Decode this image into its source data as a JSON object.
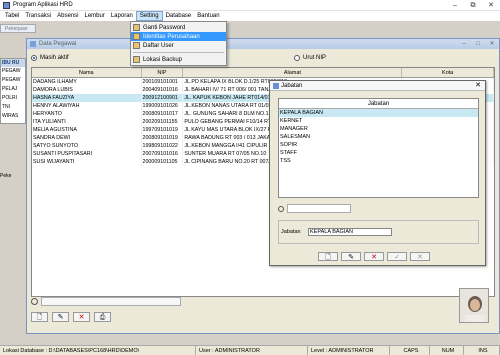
{
  "window": {
    "title": "Program Aplikasi HRD",
    "controls": [
      "–",
      "⧉",
      "✕"
    ]
  },
  "menubar": {
    "items": [
      "Tabel",
      "Transaksi",
      "Absensi",
      "Lembur",
      "Laporan",
      "Setting",
      "Database",
      "Bantuan"
    ],
    "active": "Setting"
  },
  "setting_menu": {
    "items": [
      "Ganti Password",
      "Identitas Perusahaan",
      "Daftar User"
    ],
    "highlighted": "Identitas Perusahaan",
    "after_separator": "Lokasi Backup"
  },
  "pekerjaan_panel": {
    "title": "Pekerjaan",
    "list_header": "IBU RU",
    "items": [
      "PEGAW",
      "PEGAW",
      "PELAJ",
      "POLRI",
      "TNI",
      "WIRAS"
    ],
    "footer_label": "Peke"
  },
  "data_pegawai": {
    "title": "Data Pegawai",
    "radio_active": "Masih aktif",
    "radio_sort": "Urut NIP",
    "columns": [
      "Nama",
      "NIP",
      "Alamat",
      "Kota"
    ],
    "rows": [
      [
        "DADANG ILHAMY",
        "200109101001",
        "JL.PD KELAPA IX BLOK D.1/25 RT003/013",
        ""
      ],
      [
        "DAMORA LUBIS",
        "200409101016",
        "JL BAHARI IV/ 71 RT 006/ 001 TANJUNG PRIOK",
        ""
      ],
      [
        "HASNA FAUZIYA",
        "200912100901",
        "JL. KAPUK KEBON JAHE RT014/012",
        ""
      ],
      [
        "HENNY ALAWIYAH",
        "199009101026",
        "JL.KEBON NANAS UTARA RT 01/07",
        ""
      ],
      [
        "HERYANTO",
        "200809101017",
        "JL. GUNUNG SAHARI 8 DLM NO.1 RT 013/001",
        ""
      ],
      [
        "ITA YULIANTI",
        "200209101155",
        "PULO GEBANG PERMAI F10/14 RT 005/003",
        ""
      ],
      [
        "MELIA AGUSTINA",
        "199709101019",
        "JL KAYU MAS UTARA BLOK IX/27 RT 011",
        ""
      ],
      [
        "SANDRA DEWI",
        "200809101019",
        "RAWA BADUNG RT 003 / 013 JAKARTA TIMUR",
        ""
      ],
      [
        "SATYO SUNYOTO",
        "199809101022",
        "JL.KEBON MANGGA I/41 CIPULIR RT 006/005",
        ""
      ],
      [
        "SUSANTI PUSPITASARI",
        "200709101016",
        "SUNTER MUARA RT 07/05 NO.10",
        ""
      ],
      [
        "SUSI WIJAYANTI",
        "200009101105",
        "JL CIPINANG BARU NO.20 RT 007/003",
        ""
      ]
    ],
    "selected_row": 2,
    "toolbar_icons": [
      "new-icon",
      "edit-icon",
      "delete-icon",
      "print-icon"
    ]
  },
  "jabatan": {
    "title": "Jabatan",
    "column": "Jabatan",
    "items": [
      "KEPALA BAGIAN",
      "KERNET",
      "MANAGER",
      "SALESMAN",
      "SOPIR",
      "STAFF",
      "TSS"
    ],
    "selected": "KEPALA BAGIAN",
    "field_label": "Jabatan",
    "field_value": "KEPALA BAGIAN",
    "toolbar_icons": [
      "new-icon",
      "edit-icon",
      "delete-icon",
      "save-icon",
      "cancel-icon"
    ]
  },
  "statusbar": {
    "lokasi": "Lokasi Database : D:\\DATABASES\\PC168\\HRD\\DEMO\\",
    "user": "User : ADMINISTRATOR",
    "level": "Level : ADMINISTRATOR",
    "caps": "CAPS",
    "num": "NUM",
    "ins": "INS"
  },
  "colors": {
    "selection": "#c8e8f4",
    "menu_highlight": "#3399ff",
    "accent": "#1a3e7a"
  }
}
